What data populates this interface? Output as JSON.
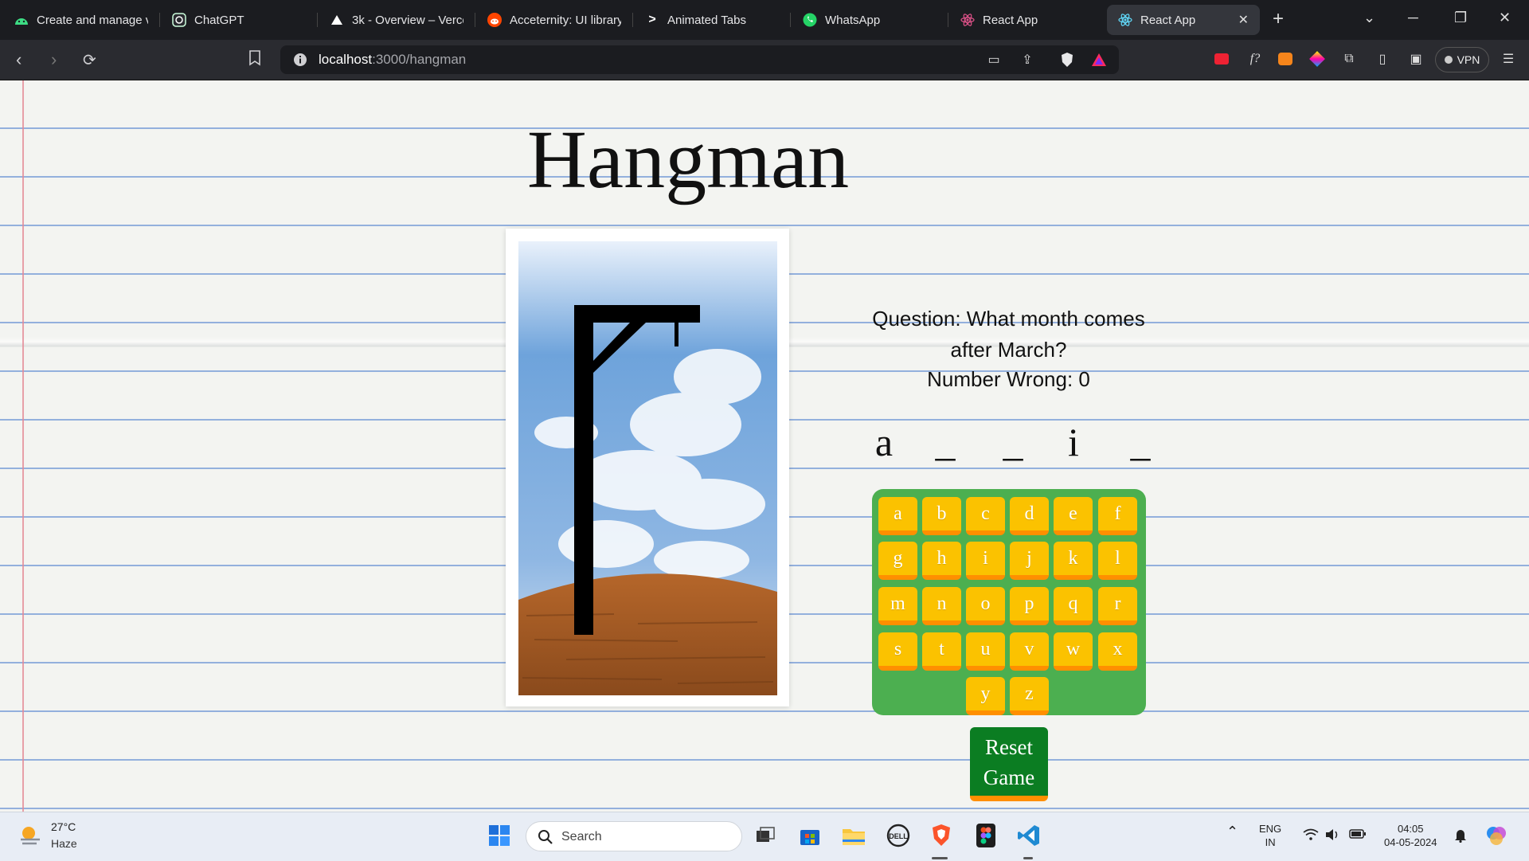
{
  "browser": {
    "tabs": [
      {
        "title": "Create and manage v",
        "icon": "android-icon"
      },
      {
        "title": "ChatGPT",
        "icon": "chatgpt-icon"
      },
      {
        "title": "3k - Overview – Verce",
        "icon": "vercel-icon"
      },
      {
        "title": "Acceternity: UI library",
        "icon": "reddit-icon"
      },
      {
        "title": "Animated Tabs",
        "icon": "chevron-icon"
      },
      {
        "title": "WhatsApp",
        "icon": "whatsapp-icon"
      },
      {
        "title": "React App",
        "icon": "react-icon"
      },
      {
        "title": "React App",
        "icon": "react-icon",
        "active": true
      }
    ],
    "url_host": "localhost",
    "url_path": ":3000/hangman",
    "vpn_label": "VPN"
  },
  "game": {
    "title": "Hangman",
    "question": "Question: What month comes after March?",
    "number_wrong": "Number Wrong: 0",
    "word_slots": [
      "a",
      "_",
      "_",
      "i",
      "_"
    ],
    "letters": [
      "a",
      "b",
      "c",
      "d",
      "e",
      "f",
      "g",
      "h",
      "i",
      "j",
      "k",
      "l",
      "m",
      "n",
      "o",
      "p",
      "q",
      "r",
      "s",
      "t",
      "u",
      "v",
      "w",
      "x",
      "y",
      "z"
    ],
    "reset_label_line1": "Reset",
    "reset_label_line2": "Game"
  },
  "taskbar": {
    "temperature": "27°C",
    "condition": "Haze",
    "search_placeholder": "Search",
    "lang_line1": "ENG",
    "lang_line2": "IN",
    "time": "04:05",
    "date": "04-05-2024"
  },
  "colors": {
    "keyboard_bg": "#4caf50",
    "key_bg": "#fbc200",
    "key_border": "#ff8f00",
    "reset_bg": "#0b7d22"
  }
}
